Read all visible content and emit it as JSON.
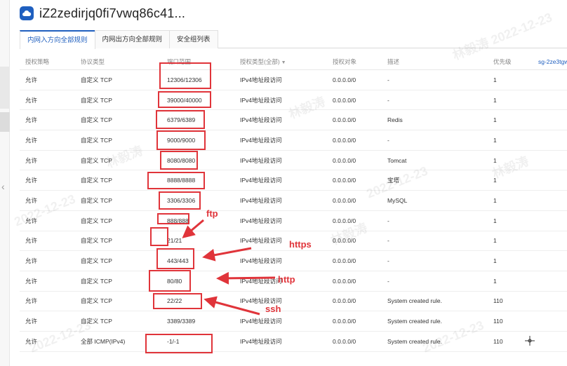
{
  "header": {
    "title": "iZ2zedirjq0fi7vwq86c41..."
  },
  "tabs": [
    {
      "label": "内网入方向全部规则"
    },
    {
      "label": "内网出方向全部规则"
    },
    {
      "label": "安全组列表"
    }
  ],
  "table": {
    "columns": [
      "授权策略",
      "协议类型",
      "端口范围",
      "授权类型(全部)",
      "授权对象",
      "描述",
      "优先级",
      "sg-2ze3tgw"
    ],
    "rows": [
      [
        "允许",
        "自定义 TCP",
        "12306/12306",
        "IPv4地址段访问",
        "0.0.0.0/0",
        "-",
        "1"
      ],
      [
        "允许",
        "自定义 TCP",
        "39000/40000",
        "IPv4地址段访问",
        "0.0.0.0/0",
        "-",
        "1"
      ],
      [
        "允许",
        "自定义 TCP",
        "6379/6389",
        "IPv4地址段访问",
        "0.0.0.0/0",
        "Redis",
        "1"
      ],
      [
        "允许",
        "自定义 TCP",
        "9000/9000",
        "IPv4地址段访问",
        "0.0.0.0/0",
        "-",
        "1"
      ],
      [
        "允许",
        "自定义 TCP",
        "8080/8080",
        "IPv4地址段访问",
        "0.0.0.0/0",
        "Tomcat",
        "1"
      ],
      [
        "允许",
        "自定义 TCP",
        "8888/8888",
        "IPv4地址段访问",
        "0.0.0.0/0",
        "宝塔",
        "1"
      ],
      [
        "允许",
        "自定义 TCP",
        "3306/3306",
        "IPv4地址段访问",
        "0.0.0.0/0",
        "MySQL",
        "1"
      ],
      [
        "允许",
        "自定义 TCP",
        "888/888",
        "IPv4地址段访问",
        "0.0.0.0/0",
        "-",
        "1"
      ],
      [
        "允许",
        "自定义 TCP",
        "21/21",
        "IPv4地址段访问",
        "0.0.0.0/0",
        "-",
        "1"
      ],
      [
        "允许",
        "自定义 TCP",
        "443/443",
        "IPv4地址段访问",
        "0.0.0.0/0",
        "-",
        "1"
      ],
      [
        "允许",
        "自定义 TCP",
        "80/80",
        "IPv4地址段访问",
        "0.0.0.0/0",
        "-",
        "1"
      ],
      [
        "允许",
        "自定义 TCP",
        "22/22",
        "IPv4地址段访问",
        "0.0.0.0/0",
        "System created rule.",
        "110"
      ],
      [
        "允许",
        "自定义 TCP",
        "3389/3389",
        "IPv4地址段访问",
        "0.0.0.0/0",
        "System created rule.",
        "110"
      ],
      [
        "允许",
        "全部 ICMP(IPv4)",
        "-1/-1",
        "IPv4地址段访问",
        "0.0.0.0/0",
        "System created rule.",
        "110"
      ]
    ]
  },
  "annotations": {
    "ftp": "ftp",
    "https": "https",
    "http": "http",
    "ssh": "ssh"
  },
  "watermark": {
    "name": "林毅涛",
    "date": "2022-12-23"
  },
  "colors": {
    "accent": "#1f5fbf",
    "annotation": "#e0343a"
  }
}
